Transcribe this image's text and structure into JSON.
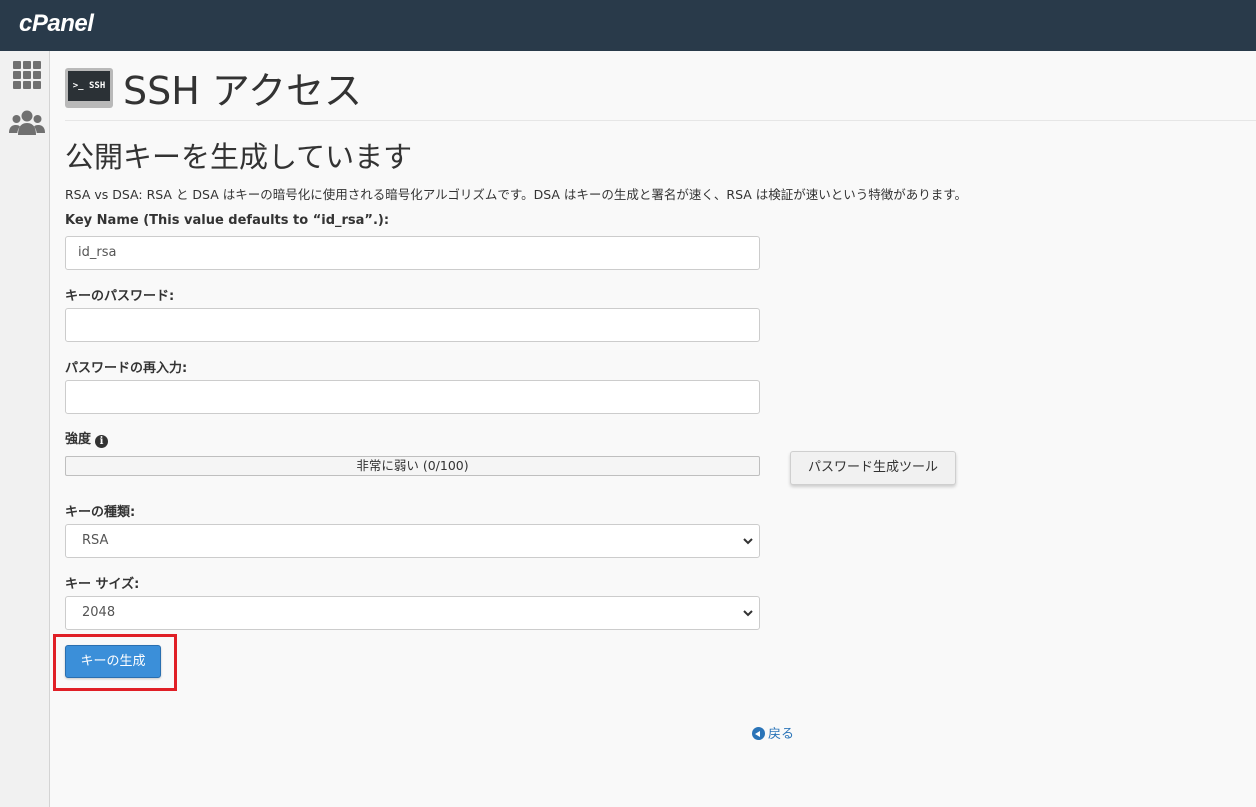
{
  "app": {
    "logo_text": "cPanel"
  },
  "sidebar": {
    "items": [
      {
        "icon": "grid-icon"
      },
      {
        "icon": "users-icon"
      }
    ]
  },
  "header": {
    "icon_text": ">_ SSH",
    "title": "SSH アクセス"
  },
  "form": {
    "section_title": "公開キーを生成しています",
    "description": "RSA vs DSA: RSA と DSA はキーの暗号化に使用される暗号化アルゴリズムです。DSA はキーの生成と署名が速く、RSA は検証が速いという特徴があります。",
    "key_name": {
      "label": "Key Name (This value defaults to “id_rsa”.):",
      "value": "id_rsa"
    },
    "key_password": {
      "label": "キーのパスワード:",
      "value": ""
    },
    "password_confirm": {
      "label": "パスワードの再入力:",
      "value": ""
    },
    "strength": {
      "label": "強度",
      "meter_text": "非常に弱い (0/100)",
      "value": 0,
      "max": 100
    },
    "password_generator_button": "パスワード生成ツール",
    "key_type": {
      "label": "キーの種類:",
      "selected": "RSA"
    },
    "key_size": {
      "label": "キー サイズ:",
      "selected": "2048"
    },
    "generate_button": "キーの生成",
    "back_link": "戻る"
  },
  "colors": {
    "topbar": "#293a4a",
    "primary_button": "#3b8fd9",
    "highlight_border": "#e01f26",
    "link": "#2a74b8"
  }
}
